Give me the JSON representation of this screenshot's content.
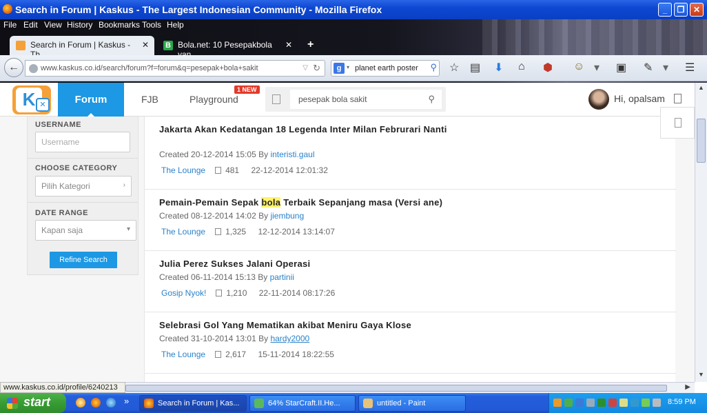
{
  "window": {
    "title": "Search in Forum | Kaskus - The Largest Indonesian Community - Mozilla Firefox"
  },
  "menubar": [
    "File",
    "Edit",
    "View",
    "History",
    "Bookmarks",
    "Tools",
    "Help"
  ],
  "tabs": [
    {
      "label": "Search in Forum | Kaskus - Th...",
      "active": true
    },
    {
      "label": "Bola.net: 10 Pesepakbola yan...",
      "active": false
    }
  ],
  "newtab_label": "+",
  "address": {
    "url": "www.kaskus.co.id/search/forum?f=forum&q=pesepak+bola+sakit"
  },
  "browser_search": {
    "engine_label": "g",
    "query": "planet earth poster"
  },
  "site_header": {
    "nav_forum": "Forum",
    "nav_fjb": "FJB",
    "nav_playground": "Playground",
    "new_badge": "1 NEW",
    "search_value": "pesepak bola sakit",
    "greeting": "Hi, opalsam"
  },
  "sidebar": {
    "username_label": "USERNAME",
    "username_placeholder": "Username",
    "category_label": "CHOOSE CATEGORY",
    "category_value": "Pilih Kategori",
    "date_label": "DATE RANGE",
    "date_value": "Kapan saja",
    "refine_button": "Refine Search"
  },
  "results": [
    {
      "title": "Jakarta Akan Kedatangan 18 Legenda Inter Milan Februrari Nanti",
      "created": "Created 20-12-2014 15:05 By",
      "author": "interisti.gaul",
      "category": "The Lounge",
      "replies": "481",
      "last": "22-12-2014 12:01:32"
    },
    {
      "title_pre": "Pemain-Pemain Sepak ",
      "title_hl": "bola",
      "title_post": " Terbaik Sepanjang masa (Versi ane)",
      "created": "Created 08-12-2014 14:02 By",
      "author": "jiembung",
      "category": "The Lounge",
      "replies": "1,325",
      "last": "12-12-2014 13:14:07"
    },
    {
      "title": "Julia Perez Sukses Jalani Operasi",
      "created": "Created 06-11-2014 15:13 By",
      "author": "partinii",
      "category": "Gosip Nyok!",
      "replies": "1,210",
      "last": "22-11-2014 08:17:26"
    },
    {
      "title": "Selebrasi Gol Yang Mematikan akibat Meniru Gaya Klose",
      "created": "Created 31-10-2014 13:01 By",
      "author": "hardy2000",
      "category": "The Lounge",
      "replies": "2,617",
      "last": "15-11-2014 18:22:55"
    }
  ],
  "status_url": "www.kaskus.co.id/profile/6240213",
  "taskbar": {
    "start": "start",
    "more": "»",
    "buttons": [
      {
        "label": "Search in Forum | Kas...",
        "active": true
      },
      {
        "label": "64% StarCraft.II.He...",
        "active": false
      },
      {
        "label": "untitled - Paint",
        "active": false
      }
    ],
    "clock": "8:59 PM"
  },
  "colors": {
    "kaskus_blue": "#1c98e4",
    "highlight": "#fff26b",
    "link": "#2a82c9",
    "xp_taskbar": "#245edb",
    "xp_start": "#379c33"
  }
}
